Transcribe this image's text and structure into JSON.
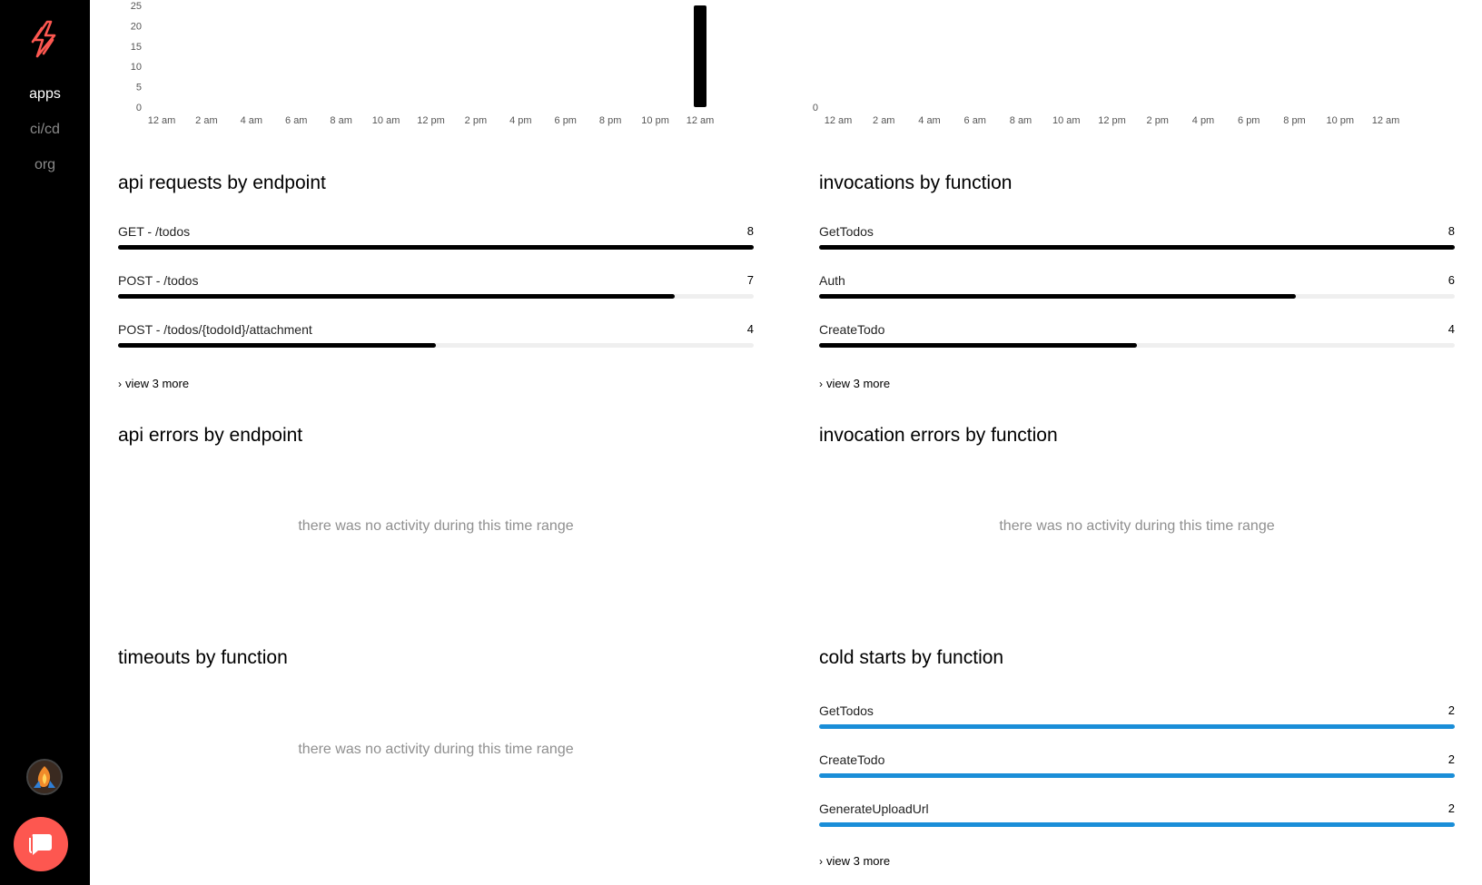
{
  "sidebar": {
    "logo_icon": "serverless-bolt-icon",
    "nav": [
      {
        "label": "apps",
        "active": true
      },
      {
        "label": "ci/cd",
        "active": false
      },
      {
        "label": "org",
        "active": false
      }
    ],
    "avatar_icon": "user-avatar-icon",
    "chat_icon": "chat-bubble-icon",
    "accent": "#fd5750"
  },
  "charts": {
    "x_ticks": [
      "12 am",
      "2 am",
      "4 am",
      "6 am",
      "8 am",
      "10 am",
      "12 pm",
      "2 pm",
      "4 pm",
      "6 pm",
      "8 pm",
      "10 pm",
      "12 am"
    ]
  },
  "chart_data": [
    {
      "type": "bar",
      "x_ticks": [
        "12 am",
        "2 am",
        "4 am",
        "6 am",
        "8 am",
        "10 am",
        "12 pm",
        "2 pm",
        "4 pm",
        "6 pm",
        "8 pm",
        "10 pm",
        "12 am"
      ],
      "y_ticks": [
        "0",
        "5",
        "10",
        "15",
        "20",
        "25"
      ],
      "ylim": [
        0,
        25
      ],
      "bars": [
        {
          "x": "12 am",
          "value": 25
        }
      ],
      "color": "#000000",
      "grid": false
    },
    {
      "type": "bar",
      "x_ticks": [
        "12 am",
        "2 am",
        "4 am",
        "6 am",
        "8 am",
        "10 am",
        "12 pm",
        "2 pm",
        "4 pm",
        "6 pm",
        "8 pm",
        "10 pm",
        "12 am"
      ],
      "y_ticks": [
        "0"
      ],
      "bars": [],
      "grid": false
    }
  ],
  "panels": {
    "api_requests": {
      "title": "api requests by endpoint",
      "max": 8,
      "rows": [
        {
          "label": "GET - /todos",
          "value": 8
        },
        {
          "label": "POST - /todos",
          "value": 7
        },
        {
          "label": "POST - /todos/{todoId}/attachment",
          "value": 4
        }
      ],
      "view_more": "view 3 more"
    },
    "invocations": {
      "title": "invocations by function",
      "max": 8,
      "rows": [
        {
          "label": "GetTodos",
          "value": 8
        },
        {
          "label": "Auth",
          "value": 6
        },
        {
          "label": "CreateTodo",
          "value": 4
        }
      ],
      "view_more": "view 3 more"
    },
    "api_errors": {
      "title": "api errors by endpoint",
      "empty": "there was no activity during this time range"
    },
    "invocation_errors": {
      "title": "invocation errors by function",
      "empty": "there was no activity during this time range"
    },
    "timeouts": {
      "title": "timeouts by function",
      "empty": "there was no activity during this time range"
    },
    "cold_starts": {
      "title": "cold starts by function",
      "max": 2,
      "bar_color": "#1a8ed8",
      "rows": [
        {
          "label": "GetTodos",
          "value": 2
        },
        {
          "label": "CreateTodo",
          "value": 2
        },
        {
          "label": "GenerateUploadUrl",
          "value": 2
        }
      ],
      "view_more": "view 3 more"
    }
  }
}
